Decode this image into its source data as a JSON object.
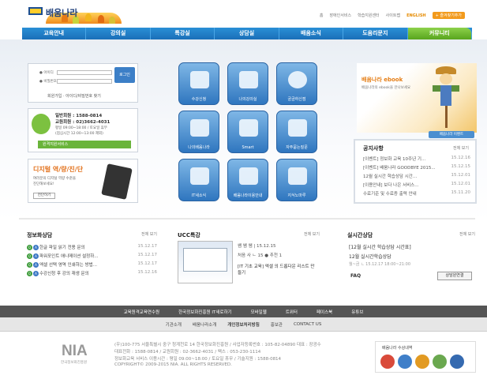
{
  "header": {
    "logo_text": "배움나라",
    "util_links": [
      "홈",
      "장애인서비스",
      "학습지원센터",
      "사이트맵"
    ],
    "english": "ENGLISH",
    "badge": "+ 즐겨찾기추가"
  },
  "nav": {
    "items": [
      "교육안내",
      "강의실",
      "특강실",
      "상담실",
      "배움소식",
      "도움리문지",
      "커뮤니티"
    ]
  },
  "login": {
    "id_label": "● 아이디",
    "pw_label": "● 비밀번호",
    "button": "로그인",
    "links": "회원가입 · 아이디/비밀번호 찾기"
  },
  "consult": {
    "phone1": "일반회원 : 1588-0814",
    "phone2": "교원회원 : 02)3662-4031",
    "hours": "평일 09:00~18:00 / 토요일 휴무",
    "lunch": "(점심시간 12:00~13:00 제외)",
    "remote": "원격지원서비스"
  },
  "digital": {
    "title": "디지털 역/량/진/단",
    "desc1": "여러분의 디지털 역량 수준을",
    "desc2": "진단해보세요!",
    "button": "진단하기"
  },
  "tiles": [
    {
      "label": "수강신청",
      "icon": "register-icon"
    },
    {
      "label": "나의강의실",
      "icon": "book-icon"
    },
    {
      "label": "궁금하신점",
      "icon": "question-icon"
    },
    {
      "label": "나의배움나라",
      "icon": "paper-icon"
    },
    {
      "label": "Smart",
      "icon": "phone-icon"
    },
    {
      "label": "자주묻는질문",
      "icon": "door-icon"
    },
    {
      "label": "IT새소식",
      "icon": "news-icon"
    },
    {
      "label": "배움나라이용안내",
      "icon": "tv-icon"
    },
    {
      "label": "지식노마루",
      "icon": "books-icon"
    }
  ],
  "ebook": {
    "title": "배움나라 ebook",
    "desc": "배움나라의 ebook을 만나보세요"
  },
  "notice": {
    "top_button": "배움나라 이벤트",
    "title": "공지사항",
    "more": "전체 보기",
    "items": [
      {
        "t": "[이벤트] 정보화 교육 10주년 기...",
        "d": "15.12.16"
      },
      {
        "t": "[이벤트] 배움나라 GOODBYE 2015...",
        "d": "15.12.15"
      },
      {
        "t": "12월 실시간 학습상담 시간...",
        "d": "15.12.01"
      },
      {
        "t": "[이용안내] 보다 나은 서비스...",
        "d": "15.12.01"
      },
      {
        "t": "수료기준 및 수료증 출력 안내",
        "d": "15.11.20"
      }
    ]
  },
  "qa": {
    "title": "정보화상담",
    "more": "전체 보기",
    "items": [
      {
        "t": "한글 파일 읽기 전용 문의",
        "d": "15.12.17"
      },
      {
        "t": "파워포인트 애니메이션 설정하...",
        "d": "15.12.17"
      },
      {
        "t": "엑셀 선택 영역 인쇄하는 방법...",
        "d": "15.12.17"
      },
      {
        "t": "수강신청 후 강의 재생 문의",
        "d": "15.12.16"
      }
    ]
  },
  "ucc": {
    "title": "UCC특강",
    "more": "전체 보기",
    "items": [
      "쌤 쌤 쌤 | 15.12.15",
      "처음 사 ㄴ 15 ● 추천 1",
      "[IT 기초 교육] 엑셀 의 드롭다운 리스트 만들기"
    ]
  },
  "live": {
    "title": "실시간상담",
    "more": "전체 보기",
    "line1": "[12월 실시간 학습상담 시간표]",
    "line2": "12월 실시간학습상담",
    "line3": "월~금 ㄴ 15.12.17 18:00~21:00",
    "faq": "FAQ",
    "button": "상담원연결"
  },
  "foot1": [
    "교육원격교육연수원",
    "한국정보화진흥원 IT새로하기",
    "모바일웹",
    "트위터",
    "페이스북",
    "유튜브"
  ],
  "foot2": [
    "기관소개",
    "배움나라소개",
    "개인정보처리방침",
    "홍보관",
    "CONTACT US"
  ],
  "footer": {
    "nia": "NIA",
    "nia_sub": "한국정보화진흥원",
    "addr1": "(우)100-775 서울특별시 중구 청계천로 14 한국정보화진흥원 / 사업자등록번호 : 105-82-04890 대표 : 장광수",
    "addr2": "대표전화 : 1588-0814 / 교원회원 : 02-3662-4031 / 팩스 : 053-230-1114",
    "addr3": "정보화교육 서비스 이용시간 : 평일 09:00~18:00 / 토요일 휴무 / 기술지원 : 1588-0814",
    "copyright": "COPYRIGHT© 2009-2015 NIA. ALL RIGHTS RESERVED.",
    "cert_title": "배움나라 수상내역"
  }
}
